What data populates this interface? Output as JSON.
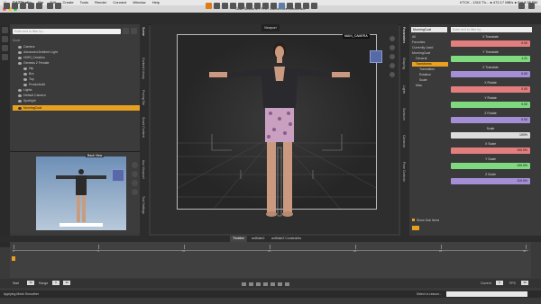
{
  "menubar": {
    "app": "DAZStudio",
    "items": [
      "File",
      "Edit",
      "Create",
      "Tools",
      "Render",
      "Connect",
      "Window",
      "Help"
    ],
    "right": "KTCK - 1310 Th...  ●  472.17 MB/s  ●  Sat 8:35 PM"
  },
  "window_title": "DAZ Studio 4.7 Pro - Zanon/SeeStream.duf",
  "scene": {
    "filter_placeholder": "Enter text to filter by...",
    "header": "Node",
    "items": [
      "Camera",
      "Advanced Ambient Light",
      "HDRI_Creation",
      "Genesis 2 Female",
      "Hip",
      "Bra",
      "Top",
      "ProductsAlt",
      "Lights",
      "Default Camera",
      "Spotlight",
      "MorningCoat"
    ]
  },
  "left_tabs": [
    "Scene",
    "Content Library",
    "Posing Tab",
    "Smart Content"
  ],
  "aux": {
    "label": "Back View"
  },
  "aux_tabs": [
    "Aux Viewport",
    "Tool Settings"
  ],
  "viewport": {
    "title": "Viewport",
    "camera_label": "MAIN_CAMERA"
  },
  "right_tabs": [
    "Parameters",
    "Shaping",
    "Lights",
    "Surfaces",
    "Cameras",
    "Pose Controls"
  ],
  "params": {
    "node": "MorningCoat",
    "filter_placeholder": "Enter text to filter by...",
    "categories": [
      "All",
      "Favorites",
      "Currently Used",
      "MorningCoat",
      "General",
      "Transforms",
      "Translation",
      "Rotation",
      "Scale",
      "Misc"
    ],
    "selected_category": "Transforms",
    "sliders": [
      {
        "label": "X Translate",
        "value": "0.00"
      },
      {
        "label": "Y Translate",
        "value": "1.21"
      },
      {
        "label": "Z Translate",
        "value": "0.00"
      },
      {
        "label": "X Rotate",
        "value": "0.00"
      },
      {
        "label": "Y Rotate",
        "value": "0.00"
      },
      {
        "label": "Z Rotate",
        "value": "0.00"
      },
      {
        "label": "Scale",
        "value": "100%"
      },
      {
        "label": "X Scale",
        "value": "100.0%"
      },
      {
        "label": "Y Scale",
        "value": "100.0%"
      },
      {
        "label": "Z Scale",
        "value": "110.0%"
      }
    ],
    "show_sub": "Show Sub Items"
  },
  "timeline": {
    "tabs": [
      "Timeline",
      "aniMate2",
      "aniMate2 Constraints"
    ],
    "active_tab": "Timeline",
    "ticks": [
      "0",
      "5",
      "10",
      "15",
      "20",
      "25",
      "30"
    ],
    "start_label": "Start",
    "start_value": "30",
    "range_label": "Range",
    "range_from": "0",
    "range_to": "30",
    "current_label": "Current",
    "current_value": "0",
    "fps_label": "FPS",
    "fps_value": "30"
  },
  "status": {
    "text": "Applying Mesh Smoother",
    "lesson_prompt": "Select a Lesson..."
  },
  "colors": {
    "selection": "#e8a021",
    "slider_red": "#e37e7e",
    "slider_green": "#7fd97f",
    "slider_purple": "#a48ed6"
  }
}
